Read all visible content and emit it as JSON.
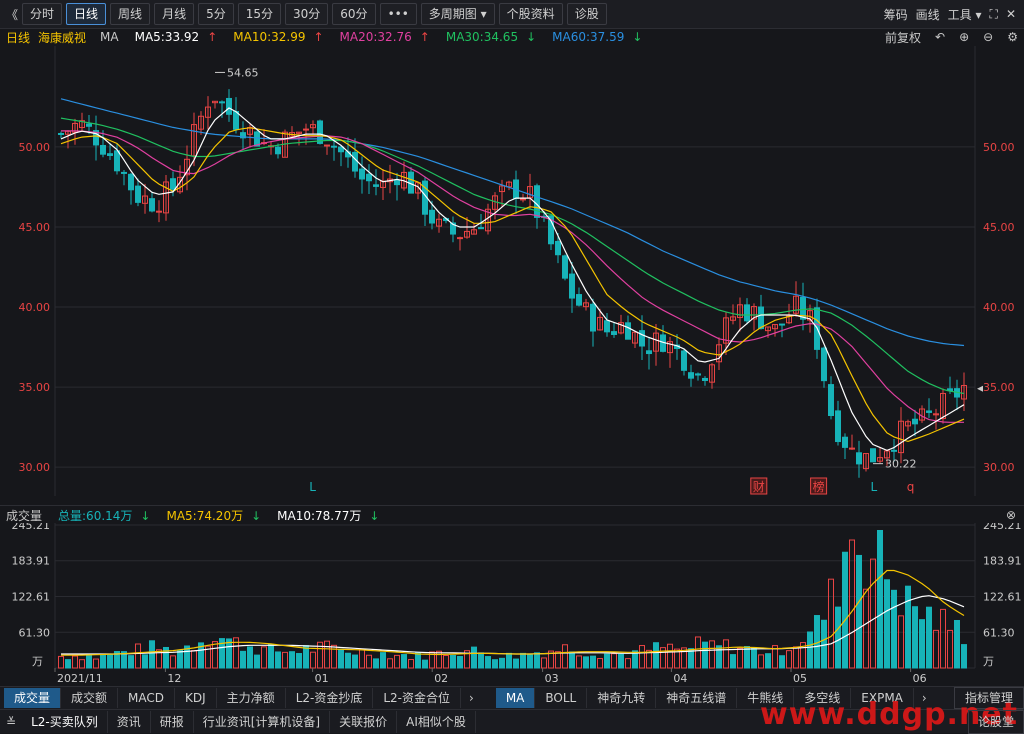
{
  "toolbar": {
    "back": "《",
    "items": [
      "分时",
      "日线",
      "周线",
      "月线",
      "5分",
      "15分",
      "30分",
      "60分"
    ],
    "active_index": 1,
    "more": "•••",
    "multi_period": "多周期图",
    "stock_info": "个股资料",
    "diagnosis": "诊股",
    "right": [
      "筹码",
      "画线",
      "工具"
    ]
  },
  "ma_legend": {
    "period": "日线",
    "stock_name": "海康威视",
    "ma": "MA",
    "ma5": "MA5:33.92",
    "ma10": "MA10:32.99",
    "ma20": "MA20:32.76",
    "ma30": "MA30:34.65",
    "ma60": "MA60:37.59",
    "adjust": "前复权"
  },
  "colors": {
    "up": "#e84444",
    "down": "#17b3b8",
    "ma5": "#ffffff",
    "ma10": "#f5c400",
    "ma20": "#e040a0",
    "ma30": "#20c060",
    "ma60": "#2a8fe0"
  },
  "chart_data": [
    {
      "type": "candlestick",
      "title": "海康威视 日线",
      "price_ticks": [
        "50.00",
        "45.00",
        "40.00",
        "35.00",
        "30.00"
      ],
      "ylim": [
        28.2,
        56.3
      ],
      "x_labels": [
        "2021/11",
        "12",
        "01",
        "02",
        "03",
        "04",
        "05",
        "06"
      ],
      "annotations": {
        "high": "54.65",
        "low": "30.22"
      },
      "markers": [
        "L",
        "财",
        "榜",
        "L",
        "q"
      ],
      "close_path": [
        50.8,
        51.5,
        50.5,
        49.0,
        47.0,
        46.5,
        47.5,
        50.5,
        53.5,
        52.0,
        51.0,
        50.0,
        50.5,
        51.2,
        50.8,
        49.5,
        48.0,
        47.5,
        48.5,
        47.0,
        45.0,
        44.5,
        45.0,
        46.5,
        47.5,
        46.8,
        44.0,
        41.0,
        39.5,
        38.5,
        39.0,
        37.5,
        38.0,
        37.0,
        35.5,
        38.0,
        40.0,
        39.5,
        38.5,
        40.0,
        39.0,
        33.0,
        31.0,
        30.5,
        31.5,
        32.5,
        33.0,
        34.0,
        35.0
      ],
      "ma_series": [
        {
          "name": "MA5",
          "values": [
            50.5,
            51.0,
            50.8,
            49.8,
            48.0,
            47.0,
            47.2,
            49.0,
            51.5,
            52.5,
            51.5,
            50.5,
            50.5,
            50.8,
            50.8,
            50.0,
            48.8,
            47.8,
            48.0,
            47.5,
            46.0,
            45.0,
            45.0,
            45.8,
            46.8,
            46.8,
            45.5,
            43.0,
            40.8,
            39.2,
            38.8,
            38.2,
            37.8,
            37.5,
            36.5,
            36.8,
            38.5,
            39.5,
            39.5,
            39.5,
            39.2,
            36.5,
            33.5,
            31.5,
            31.0,
            31.8,
            32.5,
            33.2,
            33.9
          ]
        },
        {
          "name": "MA10",
          "values": [
            50.2,
            50.6,
            50.7,
            50.2,
            49.0,
            47.8,
            47.2,
            48.0,
            49.8,
            51.0,
            51.2,
            51.0,
            50.8,
            50.7,
            50.7,
            50.4,
            49.5,
            48.6,
            48.2,
            47.8,
            46.8,
            45.8,
            45.2,
            45.3,
            45.8,
            46.3,
            46.0,
            44.8,
            42.8,
            40.8,
            39.8,
            39.0,
            38.5,
            38.0,
            37.2,
            37.0,
            37.6,
            38.6,
            39.2,
            39.5,
            39.4,
            38.2,
            35.8,
            33.5,
            32.0,
            31.6,
            32.0,
            32.5,
            33.0
          ]
        },
        {
          "name": "MA20",
          "values": [
            51.0,
            51.0,
            50.9,
            50.6,
            50.0,
            49.2,
            48.5,
            48.3,
            48.8,
            49.5,
            50.0,
            50.3,
            50.5,
            50.6,
            50.7,
            50.6,
            50.2,
            49.6,
            49.0,
            48.4,
            47.6,
            46.8,
            46.2,
            45.8,
            45.7,
            45.8,
            45.5,
            44.8,
            43.8,
            42.6,
            41.5,
            40.5,
            39.8,
            39.2,
            38.6,
            38.0,
            37.8,
            38.0,
            38.4,
            38.8,
            39.0,
            38.6,
            37.6,
            36.2,
            34.8,
            33.8,
            33.0,
            32.8,
            32.8
          ]
        },
        {
          "name": "MA30",
          "values": [
            51.8,
            51.6,
            51.4,
            51.1,
            50.7,
            50.2,
            49.7,
            49.4,
            49.4,
            49.6,
            49.8,
            50.0,
            50.2,
            50.3,
            50.4,
            50.4,
            50.2,
            49.8,
            49.3,
            48.8,
            48.2,
            47.6,
            47.0,
            46.6,
            46.3,
            46.1,
            45.8,
            45.3,
            44.6,
            43.8,
            43.0,
            42.2,
            41.5,
            40.9,
            40.3,
            39.8,
            39.5,
            39.5,
            39.6,
            39.8,
            39.9,
            39.6,
            38.9,
            38.0,
            37.0,
            36.0,
            35.3,
            34.8,
            34.6
          ]
        },
        {
          "name": "MA60",
          "values": [
            53.0,
            52.7,
            52.4,
            52.1,
            51.8,
            51.5,
            51.2,
            51.0,
            50.8,
            50.7,
            50.6,
            50.5,
            50.5,
            50.5,
            50.5,
            50.4,
            50.2,
            50.0,
            49.7,
            49.4,
            49.0,
            48.6,
            48.2,
            47.8,
            47.4,
            47.0,
            46.6,
            46.2,
            45.7,
            45.2,
            44.7,
            44.1,
            43.5,
            43.0,
            42.5,
            42.0,
            41.6,
            41.3,
            41.0,
            40.8,
            40.5,
            40.1,
            39.6,
            39.1,
            38.6,
            38.2,
            37.9,
            37.7,
            37.6
          ]
        }
      ]
    },
    {
      "type": "bar",
      "title": "成交量",
      "unit": "万",
      "y_ticks": [
        "245.21",
        "183.91",
        "122.61",
        "61.30"
      ],
      "ylim": [
        0,
        245.21
      ],
      "volume_path": [
        20,
        22,
        18,
        25,
        30,
        35,
        28,
        40,
        60,
        45,
        38,
        30,
        28,
        32,
        35,
        30,
        28,
        25,
        22,
        20,
        25,
        30,
        28,
        22,
        20,
        25,
        30,
        35,
        28,
        25,
        22,
        30,
        35,
        30,
        40,
        38,
        35,
        30,
        28,
        45,
        60,
        120,
        240,
        200,
        160,
        110,
        90,
        75,
        60
      ],
      "ma_series": [
        {
          "name": "MA5",
          "values": [
            22,
            22,
            23,
            24,
            26,
            28,
            30,
            34,
            40,
            44,
            44,
            42,
            38,
            34,
            33,
            32,
            31,
            29,
            27,
            24,
            23,
            24,
            25,
            25,
            24,
            24,
            25,
            27,
            28,
            28,
            27,
            27,
            29,
            30,
            33,
            34,
            36,
            35,
            33,
            35,
            40,
            55,
            95,
            140,
            170,
            160,
            140,
            110,
            90
          ]
        },
        {
          "name": "MA10",
          "values": [
            24,
            24,
            24,
            24,
            25,
            26,
            27,
            29,
            33,
            37,
            39,
            39,
            39,
            38,
            37,
            35,
            33,
            31,
            29,
            27,
            26,
            26,
            25,
            25,
            24,
            24,
            25,
            26,
            26,
            26,
            25,
            26,
            27,
            28,
            30,
            31,
            32,
            33,
            33,
            34,
            36,
            42,
            60,
            80,
            100,
            115,
            125,
            118,
            105
          ]
        }
      ]
    }
  ],
  "vol_legend": {
    "label": "成交量",
    "total": "总量:60.14万",
    "ma5": "MA5:74.20万",
    "ma10": "MA10:78.77万"
  },
  "indicator_tabs_left": [
    "成交量",
    "成交额",
    "MACD",
    "KDJ",
    "主力净额",
    "L2-资金抄底",
    "L2-资金合位"
  ],
  "indicator_tabs_right": [
    "MA",
    "BOLL",
    "神奇九转",
    "神奇五线谱",
    "牛熊线",
    "多空线",
    "EXPMA"
  ],
  "indicator_manage": "指标管理",
  "bottom_tabs": [
    "L2-买卖队列",
    "资讯",
    "研报",
    "行业资讯[计算机设备]",
    "关联报价",
    "AI相似个股"
  ],
  "bottom_right": "论股堂",
  "watermark": "www.ddgp.net"
}
